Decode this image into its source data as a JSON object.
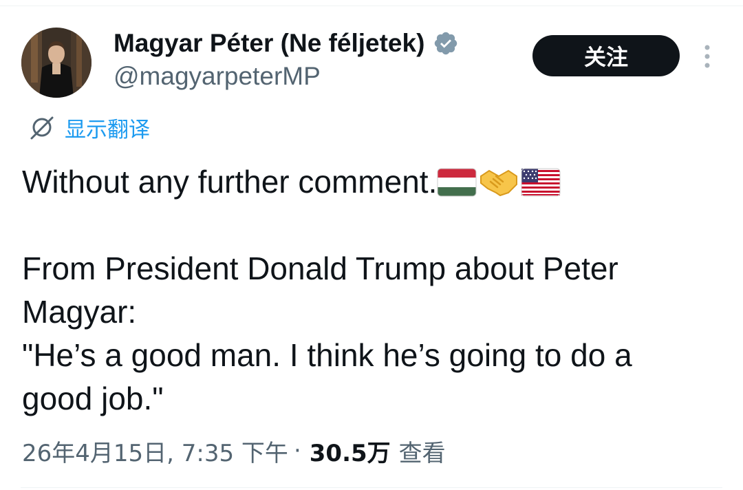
{
  "author": {
    "display_name": "Magyar Péter (Ne féljetek)",
    "handle": "@magyarpeterMP",
    "verified_badge_color": "#829aab",
    "avatar_icon": "profile-photo"
  },
  "actions": {
    "follow_label": "关注",
    "more_icon": "vertical-ellipsis-icon"
  },
  "translate": {
    "label": "显示翻译",
    "icon": "translate-globe-icon",
    "color": "#1d9bf0"
  },
  "tweet": {
    "lines": [
      "Without any further comment.",
      "",
      "From President Donald Trump about Peter",
      "Magyar:",
      "\"He’s a good man. I think he’s going to do a",
      "good job.\""
    ],
    "emojis": [
      "hungary-flag",
      "handshake",
      "usa-flag"
    ]
  },
  "meta": {
    "timestamp": "26年4月15日, 7:35 下午",
    "separator": "·",
    "views_count": "30.5万",
    "views_label": "查看"
  },
  "colors": {
    "text_primary": "#0f1419",
    "text_secondary": "#536471",
    "button_bg": "#0f1419",
    "divider": "#eff3f4"
  }
}
